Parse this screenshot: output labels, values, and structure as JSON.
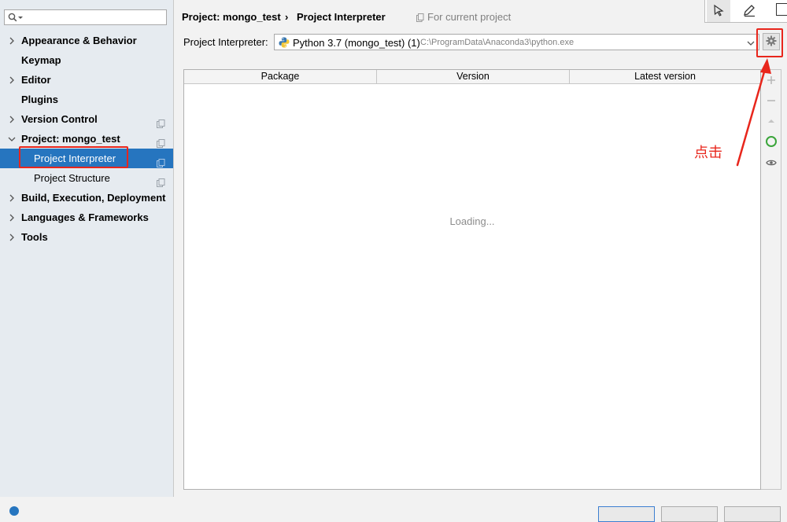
{
  "sidebar": {
    "search": {
      "placeholder": "",
      "value": ""
    },
    "items": [
      {
        "label": "Appearance & Behavior"
      },
      {
        "label": "Keymap"
      },
      {
        "label": "Editor"
      },
      {
        "label": "Plugins"
      },
      {
        "label": "Version Control"
      },
      {
        "label": "Project: mongo_test"
      },
      {
        "label": "Project Interpreter"
      },
      {
        "label": "Project Structure"
      },
      {
        "label": "Build, Execution, Deployment"
      },
      {
        "label": "Languages & Frameworks"
      },
      {
        "label": "Tools"
      }
    ],
    "selected_color": "#2675bf"
  },
  "header": {
    "breadcrumb_parent": "Project: mongo_test",
    "breadcrumb_separator": "›",
    "breadcrumb_current": "Project Interpreter",
    "scope": "For current project"
  },
  "interpreter": {
    "label": "Project Interpreter:",
    "name": "Python 3.7 (mongo_test) (1)",
    "path": "C:\\ProgramData\\Anaconda3\\python.exe"
  },
  "table": {
    "columns": [
      "Package",
      "Version",
      "Latest version"
    ],
    "loading_text": "Loading..."
  },
  "annotation": {
    "note": "点击",
    "color": "#e8261c"
  }
}
